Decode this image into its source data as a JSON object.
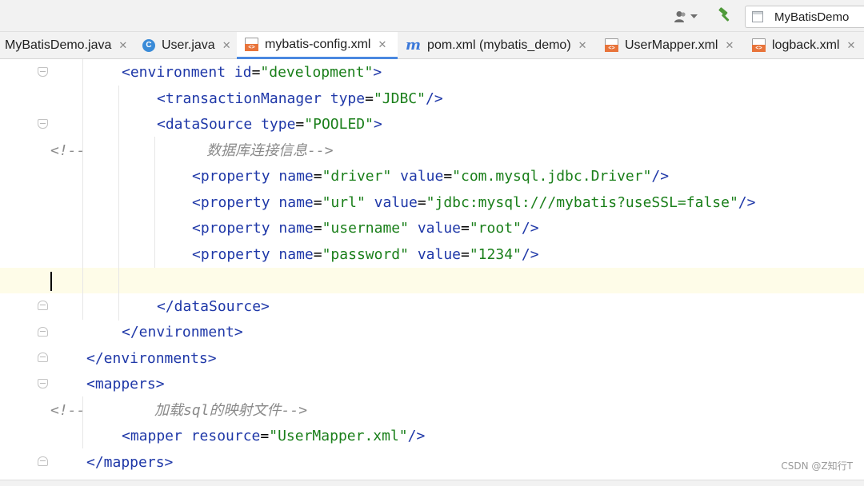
{
  "toolbar": {
    "user_icon": "user-dropdown-icon",
    "build_icon": "hammer-icon",
    "run_config": "MyBatisDemo"
  },
  "tabs": [
    {
      "label": "MyBatisDemo.java",
      "icon": "java-file-icon",
      "active": false
    },
    {
      "label": "User.java",
      "icon": "java-class-icon",
      "active": false
    },
    {
      "label": "mybatis-config.xml",
      "icon": "xml-file-icon",
      "active": true
    },
    {
      "label": "pom.xml (mybatis_demo)",
      "icon": "maven-icon",
      "active": false
    },
    {
      "label": "UserMapper.xml",
      "icon": "xml-file-icon",
      "active": false
    },
    {
      "label": "logback.xml",
      "icon": "xml-file-icon",
      "active": false
    }
  ],
  "editor": {
    "colors": {
      "tag": "#1f38a8",
      "attribute": "#1f38a8",
      "value": "#1a7f1a",
      "comment": "#8a8a8a",
      "caret_row": "#fefce8"
    },
    "lines": [
      [
        {
          "t": "tag",
          "v": "<environment"
        },
        {
          "t": "txt",
          "v": " "
        },
        {
          "t": "attr",
          "v": "id"
        },
        {
          "t": "txt",
          "v": "="
        },
        {
          "t": "val",
          "v": "\"development\""
        },
        {
          "t": "tag",
          "v": ">"
        }
      ],
      [
        {
          "t": "tag",
          "v": "<transactionManager"
        },
        {
          "t": "txt",
          "v": " "
        },
        {
          "t": "attr",
          "v": "type"
        },
        {
          "t": "txt",
          "v": "="
        },
        {
          "t": "val",
          "v": "\"JDBC\""
        },
        {
          "t": "tag",
          "v": "/>"
        }
      ],
      [
        {
          "t": "tag",
          "v": "<dataSource"
        },
        {
          "t": "txt",
          "v": " "
        },
        {
          "t": "attr",
          "v": "type"
        },
        {
          "t": "txt",
          "v": "="
        },
        {
          "t": "val",
          "v": "\"POOLED\""
        },
        {
          "t": "tag",
          "v": ">"
        }
      ],
      [
        {
          "t": "cmt",
          "v": "<!--              数据库连接信息-->"
        }
      ],
      [
        {
          "t": "tag",
          "v": "<property"
        },
        {
          "t": "txt",
          "v": " "
        },
        {
          "t": "attr",
          "v": "name"
        },
        {
          "t": "txt",
          "v": "="
        },
        {
          "t": "val",
          "v": "\"driver\""
        },
        {
          "t": "txt",
          "v": " "
        },
        {
          "t": "attr",
          "v": "value"
        },
        {
          "t": "txt",
          "v": "="
        },
        {
          "t": "val",
          "v": "\"com.mysql.jdbc.Driver\""
        },
        {
          "t": "tag",
          "v": "/>"
        }
      ],
      [
        {
          "t": "tag",
          "v": "<property"
        },
        {
          "t": "txt",
          "v": " "
        },
        {
          "t": "attr",
          "v": "name"
        },
        {
          "t": "txt",
          "v": "="
        },
        {
          "t": "val",
          "v": "\"url\""
        },
        {
          "t": "txt",
          "v": " "
        },
        {
          "t": "attr",
          "v": "value"
        },
        {
          "t": "txt",
          "v": "="
        },
        {
          "t": "val",
          "v": "\"jdbc:mysql:///mybatis?useSSL=false\""
        },
        {
          "t": "tag",
          "v": "/>"
        }
      ],
      [
        {
          "t": "tag",
          "v": "<property"
        },
        {
          "t": "txt",
          "v": " "
        },
        {
          "t": "attr",
          "v": "name"
        },
        {
          "t": "txt",
          "v": "="
        },
        {
          "t": "val",
          "v": "\"username\""
        },
        {
          "t": "txt",
          "v": " "
        },
        {
          "t": "attr",
          "v": "value"
        },
        {
          "t": "txt",
          "v": "="
        },
        {
          "t": "val",
          "v": "\"root\""
        },
        {
          "t": "tag",
          "v": "/>"
        }
      ],
      [
        {
          "t": "tag",
          "v": "<property"
        },
        {
          "t": "txt",
          "v": " "
        },
        {
          "t": "attr",
          "v": "name"
        },
        {
          "t": "txt",
          "v": "="
        },
        {
          "t": "val",
          "v": "\"password\""
        },
        {
          "t": "txt",
          "v": " "
        },
        {
          "t": "attr",
          "v": "value"
        },
        {
          "t": "txt",
          "v": "="
        },
        {
          "t": "val",
          "v": "\"1234\""
        },
        {
          "t": "tag",
          "v": "/>"
        }
      ],
      [],
      [
        {
          "t": "tag",
          "v": "</dataSource>"
        }
      ],
      [
        {
          "t": "tag",
          "v": "</environment>"
        }
      ],
      [
        {
          "t": "tag",
          "v": "</environments>"
        }
      ],
      [
        {
          "t": "tag",
          "v": "<mappers>"
        }
      ],
      [
        {
          "t": "cmt",
          "v": "<!--        加载sql的映射文件-->"
        }
      ],
      [
        {
          "t": "tag",
          "v": "<mapper"
        },
        {
          "t": "txt",
          "v": " "
        },
        {
          "t": "attr",
          "v": "resource"
        },
        {
          "t": "txt",
          "v": "="
        },
        {
          "t": "val",
          "v": "\"UserMapper.xml\""
        },
        {
          "t": "tag",
          "v": "/>"
        }
      ],
      [
        {
          "t": "tag",
          "v": "</mappers>"
        }
      ]
    ]
  },
  "watermark": "CSDN @Z知行T"
}
